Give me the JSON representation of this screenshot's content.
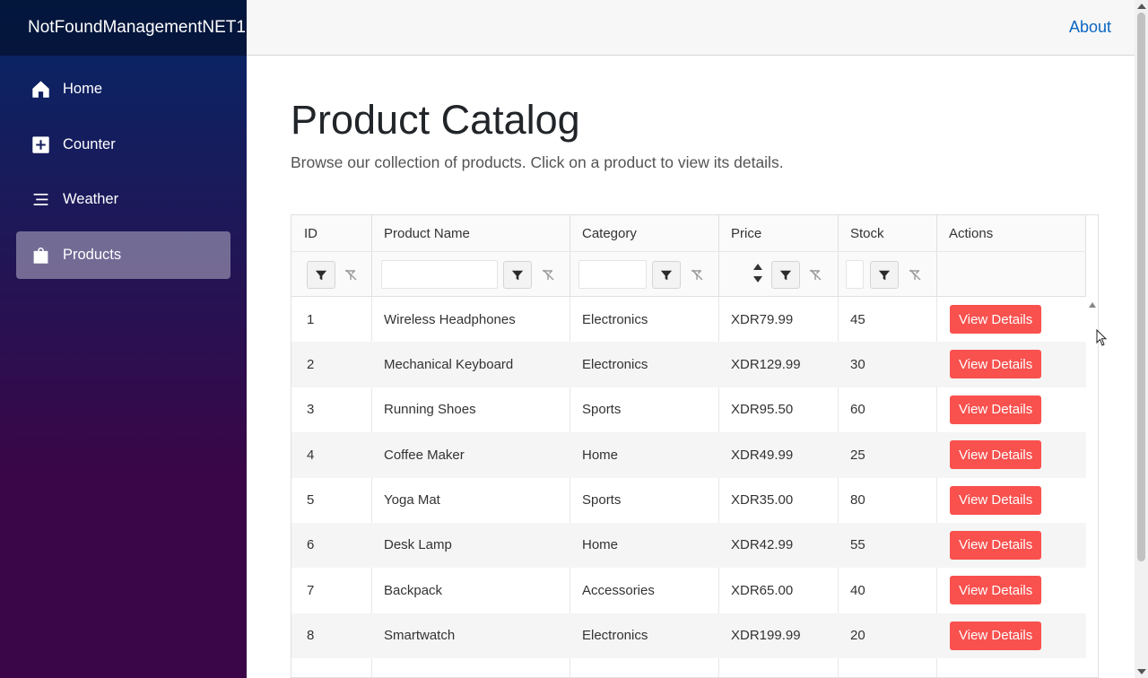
{
  "app": {
    "brand": "NotFoundManagementNET1"
  },
  "sidebar": {
    "items": [
      {
        "label": "Home",
        "icon": "home-icon",
        "active": false
      },
      {
        "label": "Counter",
        "icon": "plus-square-icon",
        "active": false
      },
      {
        "label": "Weather",
        "icon": "list-icon",
        "active": false
      },
      {
        "label": "Products",
        "icon": "bag-icon",
        "active": true
      }
    ]
  },
  "topbar": {
    "about": "About"
  },
  "page": {
    "title": "Product Catalog",
    "subtitle": "Browse our collection of products. Click on a product to view its details."
  },
  "grid": {
    "columns": [
      "ID",
      "Product Name",
      "Category",
      "Price",
      "Stock",
      "Actions"
    ],
    "action_label": "View Details",
    "rows": [
      {
        "id": "1",
        "name": "Wireless Headphones",
        "category": "Electronics",
        "price": "XDR79.99",
        "stock": "45"
      },
      {
        "id": "2",
        "name": "Mechanical Keyboard",
        "category": "Electronics",
        "price": "XDR129.99",
        "stock": "30"
      },
      {
        "id": "3",
        "name": "Running Shoes",
        "category": "Sports",
        "price": "XDR95.50",
        "stock": "60"
      },
      {
        "id": "4",
        "name": "Coffee Maker",
        "category": "Home",
        "price": "XDR49.99",
        "stock": "25"
      },
      {
        "id": "5",
        "name": "Yoga Mat",
        "category": "Sports",
        "price": "XDR35.00",
        "stock": "80"
      },
      {
        "id": "6",
        "name": "Desk Lamp",
        "category": "Home",
        "price": "XDR42.99",
        "stock": "55"
      },
      {
        "id": "7",
        "name": "Backpack",
        "category": "Accessories",
        "price": "XDR65.00",
        "stock": "40"
      },
      {
        "id": "8",
        "name": "Smartwatch",
        "category": "Electronics",
        "price": "XDR199.99",
        "stock": "20"
      }
    ]
  },
  "colors": {
    "accent_button": "#f8514e",
    "link": "#0a66c2",
    "sidebar_top": "#052767",
    "sidebar_bottom": "#3a0647"
  }
}
